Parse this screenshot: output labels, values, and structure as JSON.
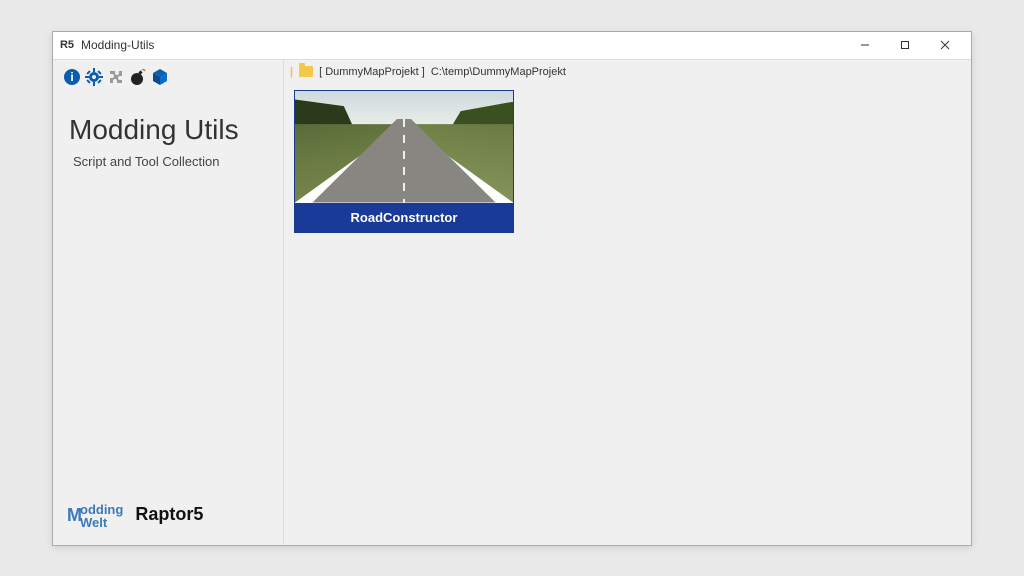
{
  "window": {
    "icon_text": "R5",
    "title": "Modding-Utils"
  },
  "sidebar": {
    "app_title": "Modding Utils",
    "app_subtitle": "Script and Tool Collection",
    "toolbar": [
      {
        "name": "info-icon",
        "color": "#0a5db0"
      },
      {
        "name": "gear-icon",
        "color": "#0a5db0"
      },
      {
        "name": "puzzle-icon",
        "color": "#9a9a9a"
      },
      {
        "name": "bomb-icon",
        "color": "#222"
      },
      {
        "name": "cube-icon",
        "color": "#0a5db0"
      }
    ],
    "footer": {
      "logo1_big": "M",
      "logo1_top": "odding",
      "logo1_bottom": "Welt",
      "logo2": "Raptor5"
    }
  },
  "main": {
    "breadcrumb": {
      "project_bracket": "[ DummyMapProjekt ]",
      "path": "C:\\temp\\DummyMapProjekt"
    },
    "cards": [
      {
        "label": "RoadConstructor"
      }
    ]
  },
  "colors": {
    "accent": "#1a3a9a",
    "icon_blue": "#0a5db0"
  }
}
